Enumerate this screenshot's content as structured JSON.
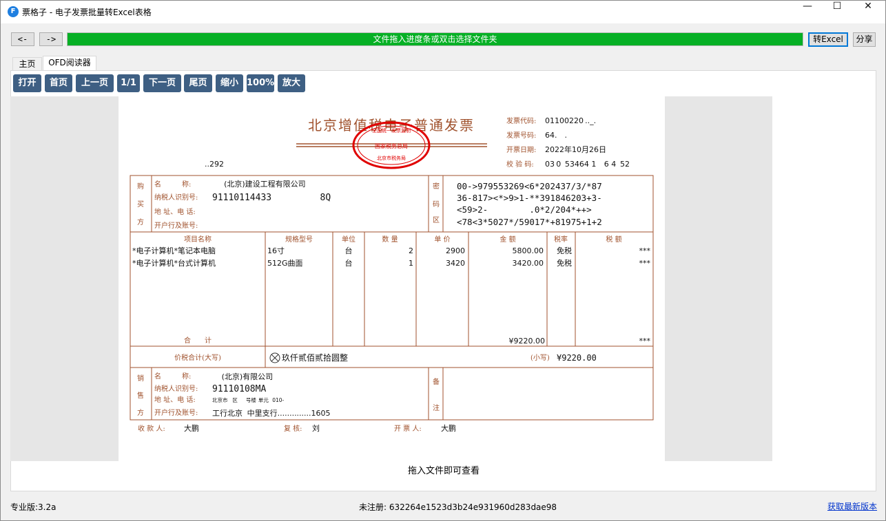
{
  "window": {
    "icon_letter": "F",
    "title": "票格子 - 电子发票批量转Excel表格",
    "minimize": "—",
    "maximize": "☐",
    "close": "✕"
  },
  "toolbar": {
    "back_label": "<-",
    "forward_label": "->",
    "drop_hint": "文件拖入进度条或双击选择文件夹",
    "to_excel_label": "转Excel",
    "share_label": "分享",
    "accent_color": "#06b025"
  },
  "tabs": [
    {
      "label": "主页",
      "active": false
    },
    {
      "label": "OFD阅读器",
      "active": true
    }
  ],
  "reader_buttons": {
    "open": "打开",
    "first": "首页",
    "prev": "上一页",
    "page": "1/1",
    "next": "下一页",
    "last": "尾页",
    "zoom_out": "缩小",
    "zoom": "100%",
    "zoom_in": "放大",
    "button_color": "#3e5f83"
  },
  "invoice": {
    "title": "北京增值税电子普通发票",
    "seal_top": "全国统一发票监制",
    "seal_mid": "国家税务总局",
    "seal_bottom": "北京市税务局",
    "code_label": "发票代码:",
    "code_value": "01100220 .._.",
    "number_label": "发票号码:",
    "number_value": "64.     .",
    "date_label": "开票日期:",
    "date_value": "2022年10月26日",
    "check_label": "校 验 码:",
    "check_value": "03 0  53464 1    6 4  52",
    "machine_no": "..292",
    "buyer": {
      "section": "购买方",
      "name_label": "名　　　称:",
      "name_value": "      (北京)建设工程有限公司",
      "taxid_label": "纳税人识别号:",
      "taxid_value": "91110114433         8Q",
      "addr_label": "地 址、电 话:",
      "bank_label": "开户行及账号:"
    },
    "cipher": {
      "section": "密码区",
      "lines": [
        "00->979553269<6*202437/3/*87",
        "36-817><*>9>1-**391846203+3-",
        "<59>2-        .0*2/204*++>",
        "<78<3*5027*/59017*+81975+1+2"
      ]
    },
    "items_header": [
      "项目名称",
      "规格型号",
      "单位",
      "数 量",
      "单 价",
      "金 额",
      "税率",
      "税 额"
    ],
    "items": [
      [
        "*电子计算机*笔记本电脑",
        "16寸",
        "台",
        "2",
        "2900",
        "5800.00",
        "免税",
        "***"
      ],
      [
        "*电子计算机*台式计算机",
        "512G曲面",
        "台",
        "1",
        "3420",
        "3420.00",
        "免税",
        "***"
      ]
    ],
    "total_label": "合　　计",
    "total_amount": "¥9220.00",
    "total_tax": "***",
    "grand_label": "价税合计(大写)",
    "grand_words": "玖仟贰佰贰拾圆整",
    "grand_small_label": "(小写)",
    "grand_small": "¥9220.00",
    "seller": {
      "section": "销售方",
      "name_label": "名　　　称:",
      "name_value": "     (北京)有限公司",
      "taxid_label": "纳税人识别号:",
      "taxid_value": "91110108MA",
      "addr_label": "地 址、电 话:",
      "addr_value": "北京市    区        号楼  单元   010-",
      "bank_label": "开户行及账号:",
      "bank_value": "工行北京   中里支行..............1605"
    },
    "remark_section": "备注",
    "payee_label": "收 款 人:",
    "payee_value": "大鹏",
    "reviewer_label": "复 核:",
    "reviewer_value": "刘",
    "drawer_label": "开 票 人:",
    "drawer_value": "大鹏"
  },
  "hint": "拖入文件即可查看",
  "status": {
    "version": "专业版:3.2a",
    "register": "未注册: 632264e1523d3b24e931960d283dae98",
    "update_link": "获取最新版本"
  }
}
